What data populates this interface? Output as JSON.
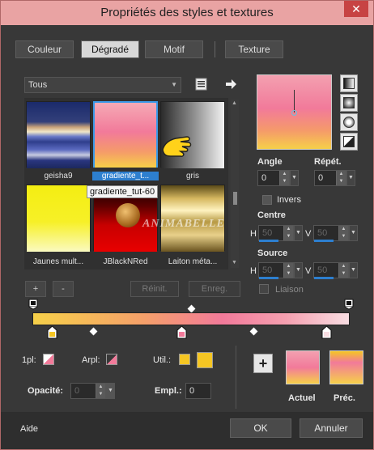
{
  "window": {
    "title": "Propriétés des styles et textures",
    "close_label": "✕"
  },
  "tabs": [
    {
      "label": "Couleur"
    },
    {
      "label": "Dégradé"
    },
    {
      "label": "Motif"
    },
    {
      "label": "Texture"
    }
  ],
  "library": {
    "category": "Tous",
    "gradients": [
      {
        "label": "geisha9"
      },
      {
        "label": "gradiente_t..."
      },
      {
        "label": "gris"
      },
      {
        "label": "Jaunes mult..."
      },
      {
        "label": "JBlackNRed"
      },
      {
        "label": "Laiton méta..."
      }
    ],
    "tooltip": "gradiente_tut-60",
    "watermark": "ANIMABELLE"
  },
  "buttons": {
    "add": "+",
    "remove": "-",
    "reset": "Réinit.",
    "save": "Enreg.",
    "help": "Aide",
    "ok": "OK",
    "cancel": "Annuler"
  },
  "settings": {
    "angle_label": "Angle",
    "angle_value": "0",
    "repeat_label": "Répét.",
    "repeat_value": "0",
    "invert_label": "Invers",
    "center_label": "Centre",
    "center_h": "50",
    "center_v": "50",
    "source_label": "Source",
    "source_h": "50",
    "source_v": "50",
    "link_label": "Liaison",
    "h": "H",
    "v": "V"
  },
  "editor": {
    "fg_label": "1pl:",
    "bg_label": "Arpl:",
    "user_label": "Util.:",
    "opacity_label": "Opacité:",
    "opacity_value": "0",
    "location_label": "Empl.:",
    "location_value": "0"
  },
  "preview": {
    "current_label": "Actuel",
    "previous_label": "Préc."
  },
  "colors": {
    "gradient_top": "#f27a9a",
    "gradient_bottom": "#f6e33a",
    "accent_blue": "#2d7fcf",
    "title_bar": "#e9a3a3"
  },
  "icons": {
    "library_menu": "list-menu-icon",
    "next": "arrow-right-icon",
    "add_stop": "plus-icon"
  }
}
